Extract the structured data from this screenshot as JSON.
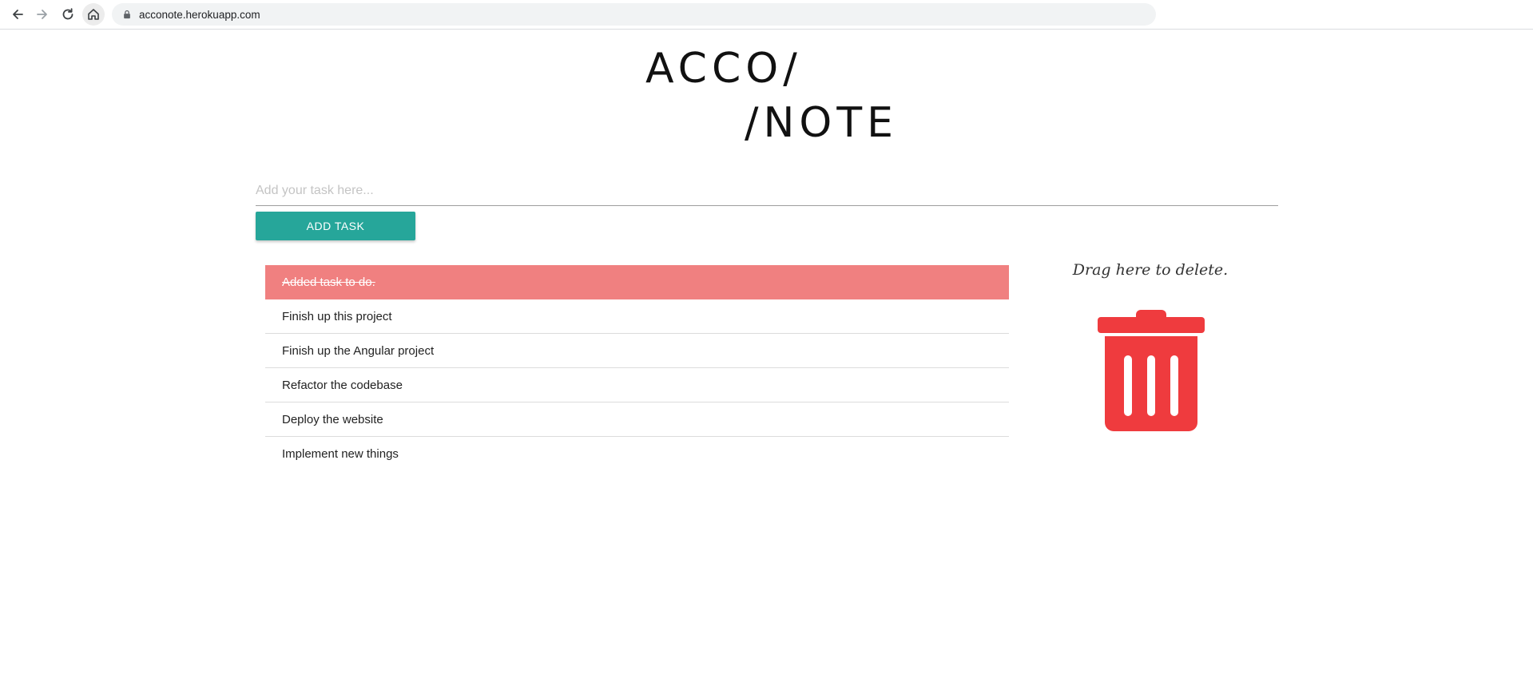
{
  "browser": {
    "url": "acconote.herokuapp.com"
  },
  "logo": {
    "line1": "ACCO/",
    "line2": "/NOTE"
  },
  "task_input": {
    "placeholder": "Add your task here...",
    "value": ""
  },
  "add_button": {
    "label": "ADD TASK"
  },
  "tasks": [
    {
      "label": "Added task to do.",
      "done": true
    },
    {
      "label": "Finish up this project",
      "done": false
    },
    {
      "label": "Finish up the Angular project",
      "done": false
    },
    {
      "label": "Refactor the codebase",
      "done": false
    },
    {
      "label": "Deploy the website",
      "done": false
    },
    {
      "label": "Implement new things",
      "done": false
    }
  ],
  "delete_zone": {
    "text": "Drag here to delete.",
    "icon": "trash-icon"
  },
  "colors": {
    "accent": "#26a69a",
    "done_task": "#f08080",
    "trash": "#ef3b3e"
  }
}
